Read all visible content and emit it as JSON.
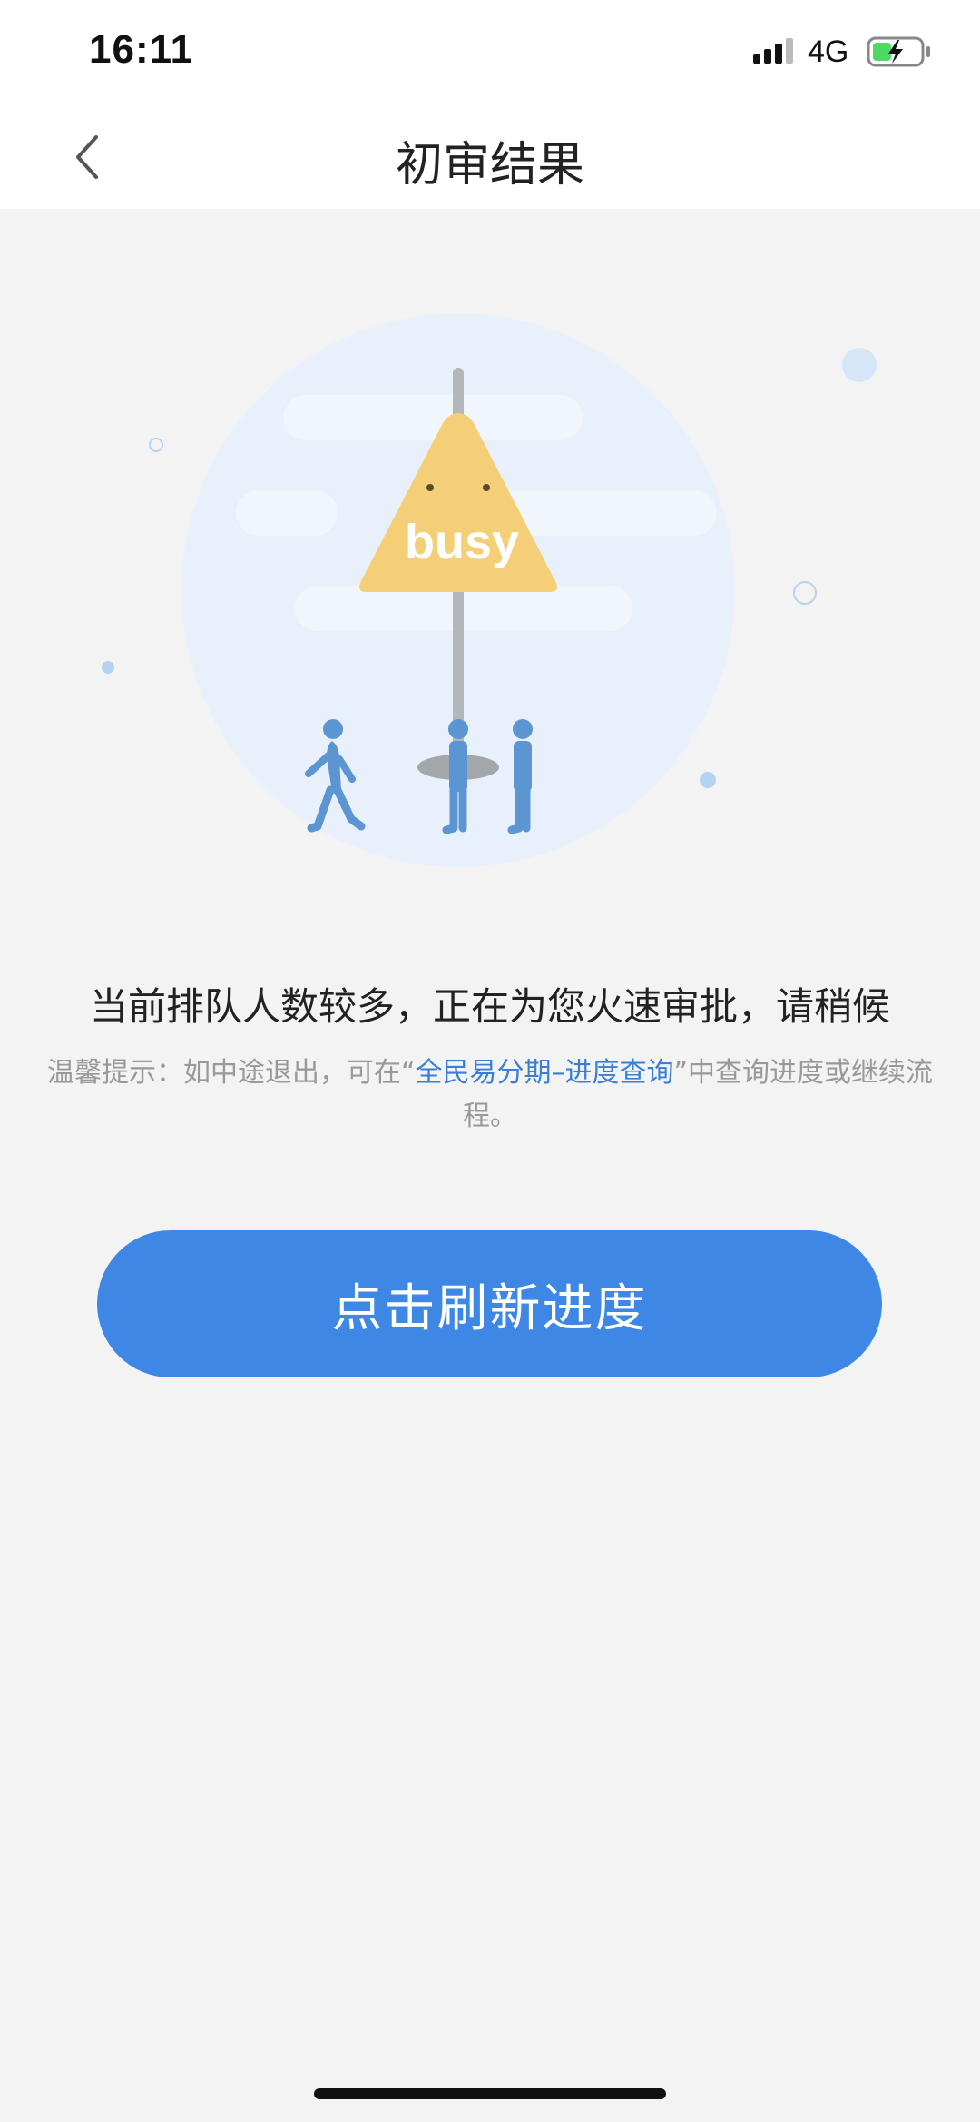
{
  "status_bar": {
    "time": "16:11",
    "network": "4G",
    "icons": [
      "signal-icon",
      "battery-charging-icon"
    ]
  },
  "nav": {
    "title": "初审结果",
    "back_icon": "chevron-left-icon"
  },
  "illustration": {
    "sign_text": "busy",
    "icon": "busy-sign-illustration"
  },
  "message": {
    "main": "当前排队人数较多，正在为您火速审批，请稍候",
    "tip_prefix": "温馨提示：如中途退出，可在“",
    "tip_link": "全民易分期–进度查询",
    "tip_suffix": "”中查询进度或继续流程。"
  },
  "button": {
    "label": "点击刷新进度"
  },
  "colors": {
    "primary": "#3e87e5",
    "link": "#3a7fd4",
    "background": "#f3f3f3",
    "sign": "#f5cf78",
    "figure": "#5b96d3"
  }
}
